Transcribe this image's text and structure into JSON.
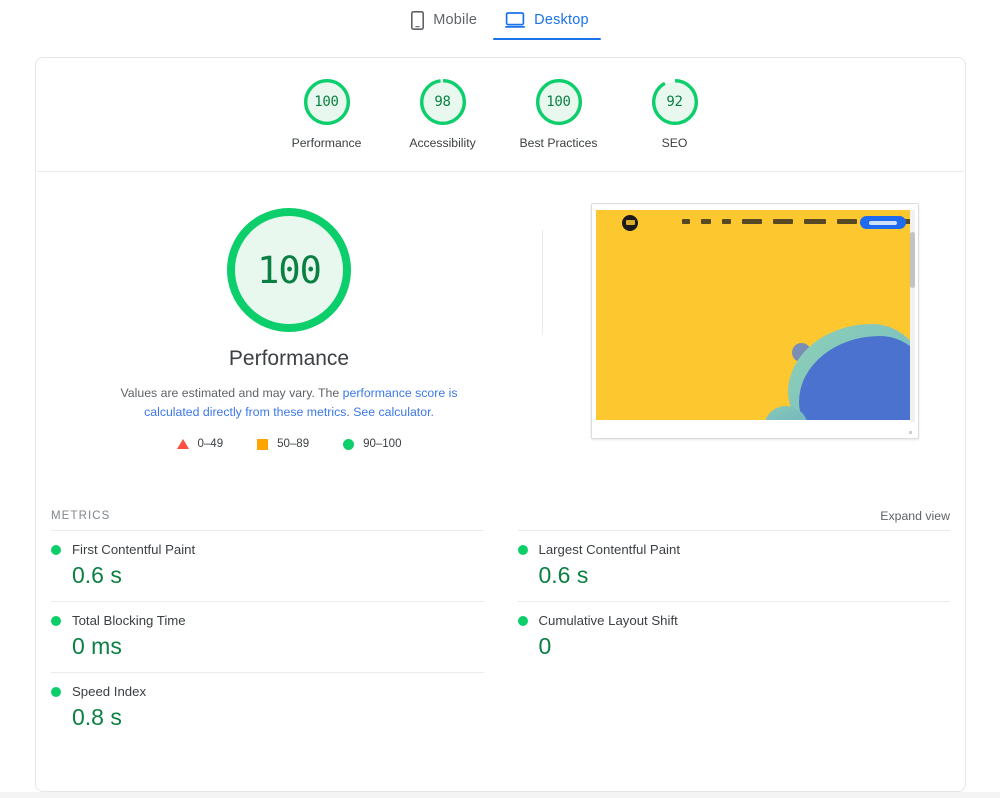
{
  "tabs": [
    {
      "label": "Mobile",
      "icon": "mobile-phone-icon",
      "active": false
    },
    {
      "label": "Desktop",
      "icon": "desktop-monitor-icon",
      "active": true
    }
  ],
  "category_scores": [
    {
      "label": "Performance",
      "value": "100",
      "pct": 100
    },
    {
      "label": "Accessibility",
      "value": "98",
      "pct": 98
    },
    {
      "label": "Best Practices",
      "value": "100",
      "pct": 100
    },
    {
      "label": "SEO",
      "value": "92",
      "pct": 92
    }
  ],
  "hero": {
    "score": "100",
    "score_pct": 100,
    "title": "Performance",
    "description_before": "Values are estimated and may vary. The ",
    "description_link1": "performance score is calculated directly from these metrics",
    "description_middle": ". ",
    "description_link2": "See calculator.",
    "legend": [
      {
        "shape": "triangle",
        "label": "0–49",
        "color": "#ff4e42"
      },
      {
        "shape": "square",
        "label": "50–89",
        "color": "#ffa400"
      },
      {
        "shape": "circle",
        "label": "90–100",
        "color": "#0cce6b"
      }
    ]
  },
  "metrics_section": {
    "title": "METRICS",
    "expand_label": "Expand view",
    "left_column": [
      {
        "name": "First Contentful Paint",
        "value": "0.6 s",
        "status_color": "#0cce6b"
      },
      {
        "name": "Total Blocking Time",
        "value": "0 ms",
        "status_color": "#0cce6b"
      },
      {
        "name": "Speed Index",
        "value": "0.8 s",
        "status_color": "#0cce6b"
      }
    ],
    "right_column": [
      {
        "name": "Largest Contentful Paint",
        "value": "0.6 s",
        "status_color": "#0cce6b"
      },
      {
        "name": "Cumulative Layout Shift",
        "value": "0",
        "status_color": "#0cce6b"
      }
    ]
  },
  "theme": {
    "green": "#0cce6b",
    "green_text": "#0b8043",
    "green_fill": "#e8f8ef",
    "blue": "#1a73e8",
    "link_blue": "#3b78e7",
    "orange": "#ffa400",
    "red": "#ff4e42",
    "text": "#3c4043",
    "muted": "#5f6368"
  }
}
